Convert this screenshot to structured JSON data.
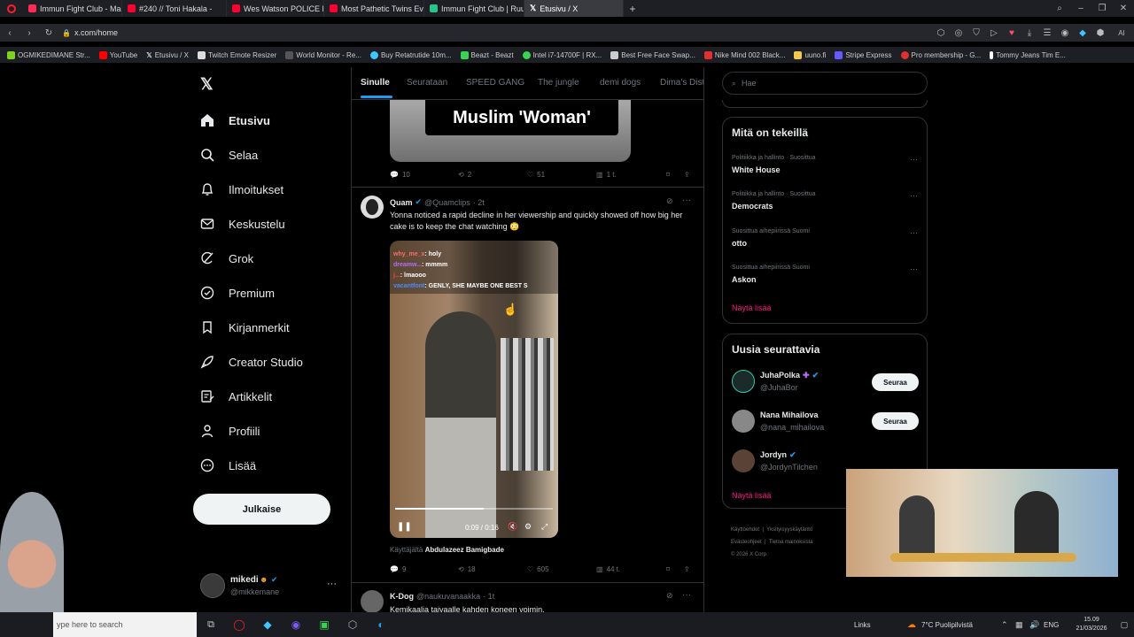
{
  "browser": {
    "tabs": [
      {
        "title": "Immun Fight Club - Mag",
        "color": "#ff2a55"
      },
      {
        "title": "#240 // Toni Hakala -",
        "color": "#ff0033"
      },
      {
        "title": "Wes Watson POLICE REPO",
        "color": "#ff0033"
      },
      {
        "title": "Most Pathetic Twins Ever",
        "color": "#ff0033"
      },
      {
        "title": "Immun Fight Club | Ruutu",
        "color": "#27c48d"
      },
      {
        "title": "Etusivu / X",
        "color": "#ffffff"
      }
    ],
    "url": "x.com/home",
    "bookmarks": [
      "OGMIKEDIMANE Str...",
      "YouTube",
      "Etusivu / X",
      "Twitch Emote Resizer",
      "World Monitor - Re...",
      "Buy Retatrutide 10m...",
      "Beazt - Beazt",
      "Intel i7-14700F | RX...",
      "Best Free Face Swap...",
      "Nike Mind 002 Black...",
      "uuno.fi",
      "Stripe Express",
      "Pro membership - G...",
      "Tommy Jeans Tim E..."
    ]
  },
  "nav": {
    "items": [
      "Etusivu",
      "Selaa",
      "Ilmoitukset",
      "Keskustelu",
      "Grok",
      "Premium",
      "Kirjanmerkit",
      "Creator Studio",
      "Artikkelit",
      "Profiili",
      "Lisää"
    ],
    "post_label": "Julkaise",
    "user_name": "mikedi",
    "user_handle": "@mikkemane"
  },
  "feed": {
    "tabs": [
      "Sinulle",
      "Seurataan",
      "SPEED GANG",
      "The jungle",
      "demi dogs",
      "Dima's Dist"
    ],
    "prev_post": {
      "caption": "Muslim 'Woman'",
      "replies": "10",
      "reposts": "2",
      "likes": "51",
      "views": "1 t."
    },
    "post": {
      "name": "Quam",
      "handle": "@Quamclips",
      "time": "· 2t",
      "text": "Yonna noticed a rapid decline in her viewership and quickly showed off how big her cake is to keep the chat watching 😳",
      "chat": [
        {
          "user": "why_me_x",
          "msg": ": holy",
          "color": "#ff6b6b"
        },
        {
          "user": "dreamw...",
          "msg": ": mmmm",
          "color": "#b36bff"
        },
        {
          "user": "j...",
          "msg": ": lmaooo",
          "color": "#ff4444"
        },
        {
          "user": "vacantfont",
          "msg": ": GENLY, SHE MAYBE ONE BEST S",
          "color": "#4a8cff"
        }
      ],
      "video_time": "0:09 / 0:16",
      "video_progress": 0.56,
      "credit_prefix": "Käyttäjältä",
      "credit_name": "Abdulazeez Bamigbade",
      "replies": "9",
      "reposts": "18",
      "likes": "605",
      "views": "44 t."
    },
    "next_post": {
      "name": "K-Dog",
      "handle": "@naukuvanaakka",
      "time": "· 1t",
      "text": "Kemikaalia taivaalle kahden koneen voimin."
    }
  },
  "right": {
    "search_placeholder": "Hae",
    "trends_title": "Mitä on tekeillä",
    "trends": [
      {
        "cat": "Politiikka ja hallinto · Suosittua",
        "name": "White House"
      },
      {
        "cat": "Politiikka ja hallinto · Suosittua",
        "name": "Democrats"
      },
      {
        "cat": "Suosittua aihepiirissä Suomi",
        "name": "otto"
      },
      {
        "cat": "Suosittua aihepiirissä Suomi",
        "name": "Askon"
      }
    ],
    "show_more": "Näytä lisää",
    "who_title": "Uusia seurattavia",
    "who": [
      {
        "name": "JuhaPolka",
        "handle": "@JuhaBor",
        "follow": "Seuraa"
      },
      {
        "name": "Nana Mihailova",
        "handle": "@nana_mihailova",
        "follow": "Seuraa"
      },
      {
        "name": "Jordyn",
        "handle": "@JordynTilchen",
        "follow": ""
      }
    ],
    "footer": [
      "Käyttöehdot",
      "Yksityisyyskäytäntö",
      "Evästeohjeet",
      "Tietoa mainoksista",
      "© 2026 X Corp."
    ]
  },
  "taskbar": {
    "search": "ype here to search",
    "links": "Links",
    "weather": "7°C Puolipilvistä",
    "lang": "ENG",
    "time": "15.09",
    "date": "21/03/2026"
  }
}
